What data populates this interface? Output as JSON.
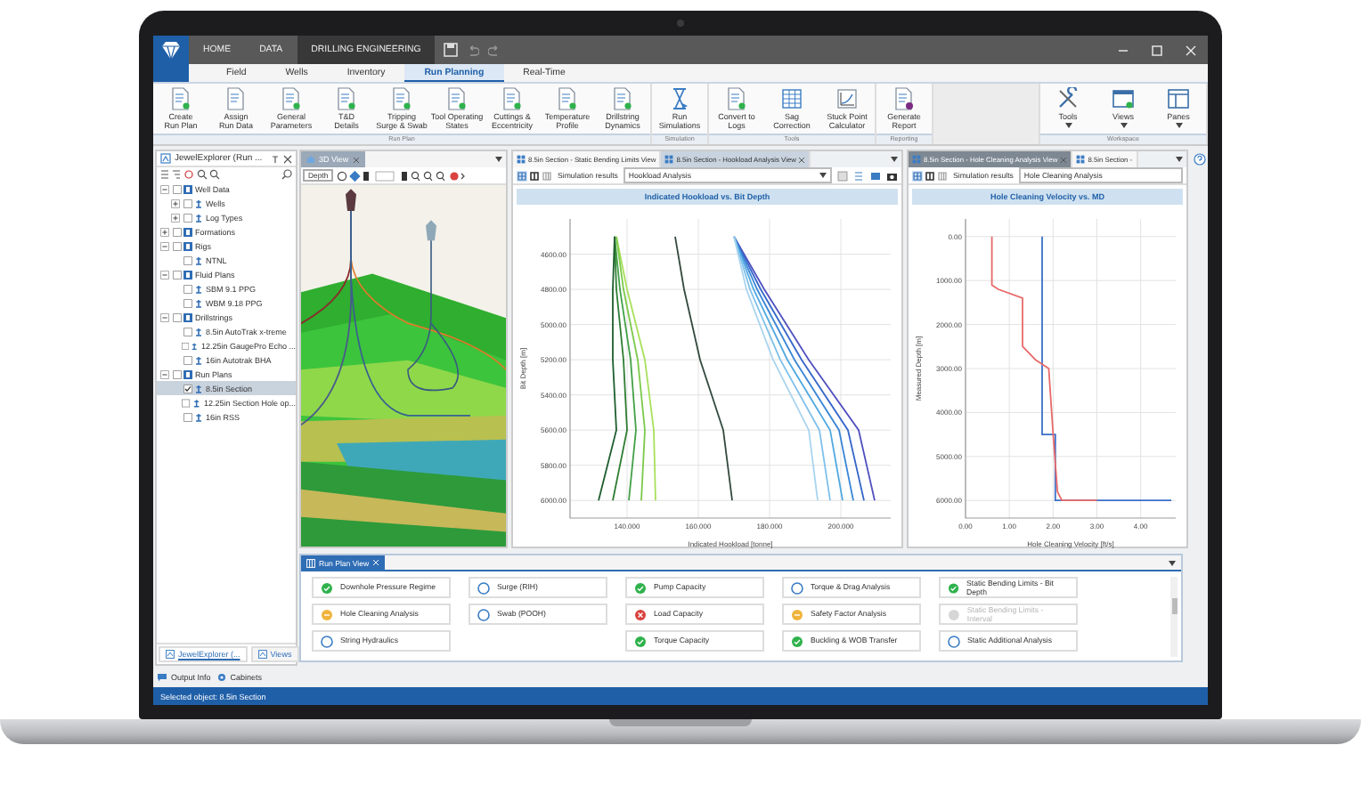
{
  "window": {
    "menu_tabs": [
      {
        "label": "HOME",
        "selected": false
      },
      {
        "label": "DATA",
        "selected": false
      },
      {
        "label": "DRILLING ENGINEERING",
        "selected": true
      }
    ]
  },
  "ribbon_tabs": [
    {
      "label": "Field",
      "selected": false
    },
    {
      "label": "Wells",
      "selected": false
    },
    {
      "label": "Inventory",
      "selected": false
    },
    {
      "label": "Run Planning",
      "selected": true
    },
    {
      "label": "Real-Time",
      "selected": false
    }
  ],
  "ribbon_groups": [
    {
      "label": "Run Plan",
      "buttons": [
        {
          "label": "Create\nRun Plan",
          "kind": "doc",
          "dropdown": false
        },
        {
          "label": "Assign\nRun Data",
          "kind": "list",
          "dropdown": false
        },
        {
          "label": "General\nParameters",
          "kind": "doc",
          "dropdown": false
        },
        {
          "label": "T&D\nDetails",
          "kind": "doc",
          "dropdown": false
        },
        {
          "label": "Tripping\nSurge & Swab",
          "kind": "doc",
          "dropdown": false
        },
        {
          "label": "Tool Operating\nStates",
          "kind": "doc",
          "dropdown": false
        },
        {
          "label": "Cuttings &\nEccentricity",
          "kind": "doc",
          "dropdown": false
        },
        {
          "label": "Temperature\nProfile",
          "kind": "doc",
          "dropdown": false
        },
        {
          "label": "Drillstring\nDynamics",
          "kind": "doc",
          "dropdown": false
        }
      ]
    },
    {
      "label": "Simulation",
      "buttons": [
        {
          "label": "Run\nSimulations",
          "kind": "hourglass",
          "dropdown": false
        }
      ]
    },
    {
      "label": "Tools",
      "buttons": [
        {
          "label": "Convert to\nLogs",
          "kind": "doc",
          "dropdown": false
        },
        {
          "label": "Sag\nCorrection",
          "kind": "table",
          "dropdown": false
        },
        {
          "label": "Stuck Point\nCalculator",
          "kind": "chart",
          "dropdown": false
        }
      ]
    },
    {
      "label": "Reporting",
      "buttons": [
        {
          "label": "Generate\nReport",
          "kind": "report",
          "dropdown": false
        }
      ]
    },
    {
      "label": "Workspace",
      "buttons": [
        {
          "label": "Tools",
          "kind": "tools",
          "dropdown": true
        },
        {
          "label": "Views",
          "kind": "window",
          "dropdown": true
        },
        {
          "label": "Panes",
          "kind": "panes",
          "dropdown": true
        }
      ]
    }
  ],
  "explorer": {
    "title": "JewelExplorer (Run ...",
    "tree": [
      {
        "label": "Well Data",
        "expanded": true,
        "checked": false,
        "selected": false,
        "children": [
          {
            "label": "Wells",
            "expanded": false,
            "checked": false,
            "selected": false
          },
          {
            "label": "Log Types",
            "expanded": false,
            "checked": false,
            "selected": false
          }
        ]
      },
      {
        "label": "Formations",
        "expanded": false,
        "checked": false,
        "selected": false
      },
      {
        "label": "Rigs",
        "expanded": true,
        "checked": false,
        "selected": false,
        "children": [
          {
            "label": "NTNL",
            "checked": false,
            "selected": false
          }
        ]
      },
      {
        "label": "Fluid Plans",
        "expanded": true,
        "checked": false,
        "selected": false,
        "children": [
          {
            "label": "SBM 9.1 PPG",
            "checked": false,
            "selected": false
          },
          {
            "label": "WBM 9.18 PPG",
            "checked": false,
            "selected": false
          }
        ]
      },
      {
        "label": "Drillstrings",
        "expanded": true,
        "checked": false,
        "selected": false,
        "children": [
          {
            "label": "8.5in AutoTrak x-treme",
            "checked": false,
            "selected": false
          },
          {
            "label": "12.25in GaugePro Echo ...",
            "checked": false,
            "selected": false
          },
          {
            "label": "16in Autotrak BHA",
            "checked": false,
            "selected": false
          }
        ]
      },
      {
        "label": "Run Plans",
        "expanded": true,
        "checked": false,
        "selected": false,
        "children": [
          {
            "label": "8.5in Section",
            "checked": true,
            "selected": true
          },
          {
            "label": "12.25in Section Hole op...",
            "checked": false,
            "selected": false
          },
          {
            "label": "16in RSS",
            "checked": false,
            "selected": false
          }
        ]
      }
    ],
    "bottom_tabs": [
      {
        "label": "JewelExplorer (...",
        "selected": true
      },
      {
        "label": "Views",
        "selected": false
      }
    ]
  },
  "view_3d": {
    "tab": "3D View",
    "depth_label": "Depth"
  },
  "doc_panes": [
    {
      "tabs": [
        {
          "label": "8.5in Section - Static Bending Limits View",
          "selected": false
        },
        {
          "label": "8.5in Section - Hookload Analysis View",
          "selected": true
        }
      ],
      "simulation_label": "Simulation results",
      "simulation_value": "Hookload Analysis",
      "chart_data": {
        "type": "line",
        "title": "Indicated Hookload vs. Bit Depth",
        "xlabel": "Indicated Hookload [tonne]",
        "ylabel": "Bit Depth [m]",
        "grid": true,
        "xlim": [
          124,
          214
        ],
        "ylim": [
          6100,
          4400
        ],
        "xticks": [
          {
            "value": 140,
            "label": "140.000"
          },
          {
            "value": 160,
            "label": "160.000"
          },
          {
            "value": 180,
            "label": "180.000"
          },
          {
            "value": 200,
            "label": "200.000"
          }
        ],
        "yticks": [
          {
            "value": 4600,
            "label": "4600.00"
          },
          {
            "value": 4800,
            "label": "4800.00"
          },
          {
            "value": 5000,
            "label": "5000.00"
          },
          {
            "value": 5200,
            "label": "5200.00"
          },
          {
            "value": 5400,
            "label": "5400.00"
          },
          {
            "value": 5600,
            "label": "5600.00"
          },
          {
            "value": 5800,
            "label": "5800.00"
          },
          {
            "value": 6000,
            "label": "6000.00"
          }
        ],
        "series": [
          {
            "color": "#1e5e2e",
            "x": [
              136.5,
              136,
              136,
              137,
              132
            ],
            "values": [
              4500,
              4800,
              5200,
              5600,
              6000
            ]
          },
          {
            "color": "#2e7d32",
            "x": [
              136.5,
              137,
              139,
              140,
              136
            ],
            "values": [
              4500,
              4800,
              5200,
              5600,
              6000
            ]
          },
          {
            "color": "#43a047",
            "x": [
              136.5,
              138,
              141,
              142.5,
              140.5
            ],
            "values": [
              4500,
              4800,
              5200,
              5600,
              6000
            ]
          },
          {
            "color": "#7cc94a",
            "x": [
              137,
              139,
              143,
              145,
              144
            ],
            "values": [
              4500,
              4800,
              5200,
              5600,
              6000
            ]
          },
          {
            "color": "#a8e05a",
            "x": [
              137,
              140,
              145,
              147.5,
              148
            ],
            "values": [
              4500,
              4800,
              5200,
              5600,
              6000
            ]
          },
          {
            "color": "#33493d",
            "x": [
              153.5,
              156,
              160.5,
              167,
              169.5
            ],
            "values": [
              4500,
              4800,
              5200,
              5600,
              6000
            ]
          },
          {
            "color": "#a8d4f0",
            "x": [
              170,
              173.5,
              181,
              191,
              193.5
            ],
            "values": [
              4500,
              4800,
              5200,
              5600,
              6000
            ]
          },
          {
            "color": "#7ec0ea",
            "x": [
              170,
              174.5,
              183,
              194,
              197
            ],
            "values": [
              4500,
              4800,
              5200,
              5600,
              6000
            ]
          },
          {
            "color": "#4fa8e0",
            "x": [
              170,
              175.5,
              185,
              197,
              200.5
            ],
            "values": [
              4500,
              4800,
              5200,
              5600,
              6000
            ]
          },
          {
            "color": "#3a86d6",
            "x": [
              170,
              176.5,
              187,
              199.5,
              203.5
            ],
            "values": [
              4500,
              4800,
              5200,
              5600,
              6000
            ]
          },
          {
            "color": "#3566c9",
            "x": [
              170,
              177.5,
              189,
              202,
              206.5
            ],
            "values": [
              4500,
              4800,
              5200,
              5600,
              6000
            ]
          },
          {
            "color": "#5050c0",
            "x": [
              170,
              178.5,
              191,
              205,
              209.5
            ],
            "values": [
              4500,
              4800,
              5200,
              5600,
              6000
            ]
          }
        ]
      }
    },
    {
      "tabs": [
        {
          "label": "8.5in Section - Hole Cleaning Analysis View",
          "selected": true
        },
        {
          "label": "8.5in Section -",
          "selected": false
        }
      ],
      "simulation_label": "Simulation results",
      "simulation_value": "Hole Cleaning Analysis",
      "chart_data": {
        "type": "line",
        "title": "Hole Cleaning Velocity vs. MD",
        "xlabel": "Hole Cleaning Velocity [ft/s]",
        "ylabel": "Measured Depth [m]",
        "grid": true,
        "xlim": [
          0,
          4.8
        ],
        "ylim": [
          6400,
          -400
        ],
        "xticks": [
          {
            "value": 0,
            "label": "0.00"
          },
          {
            "value": 1,
            "label": "1.00"
          },
          {
            "value": 2,
            "label": "2.00"
          },
          {
            "value": 3,
            "label": "3.00"
          },
          {
            "value": 4,
            "label": "4.00"
          }
        ],
        "yticks": [
          {
            "value": 0,
            "label": "0.00"
          },
          {
            "value": 1000,
            "label": "1000.00"
          },
          {
            "value": 2000,
            "label": "2000.00"
          },
          {
            "value": 3000,
            "label": "3000.00"
          },
          {
            "value": 4000,
            "label": "4000.00"
          },
          {
            "value": 5000,
            "label": "5000.00"
          },
          {
            "value": 6000,
            "label": "6000.00"
          }
        ],
        "series": [
          {
            "color": "#e86a6a",
            "x": [
              0.6,
              0.6,
              0.75,
              1.3,
              1.3,
              1.6,
              1.9,
              2.0,
              2.1,
              2.2,
              3.0
            ],
            "values": [
              0,
              1100,
              1200,
              1400,
              2500,
              2800,
              3000,
              4500,
              5800,
              6000,
              6000
            ]
          },
          {
            "color": "#3a6fc9",
            "x": [
              1.75,
              1.75,
              2.05,
              2.05,
              4.7
            ],
            "values": [
              0,
              4500,
              4500,
              6000,
              6000
            ]
          }
        ]
      }
    }
  ],
  "run_plan": {
    "tab": "Run Plan View",
    "columns": [
      [
        {
          "label": "Downhole Pressure Regime",
          "kind": "ok"
        },
        {
          "label": "Hole Cleaning Analysis",
          "kind": "warning"
        },
        {
          "label": "String Hydraulics",
          "kind": "pending"
        }
      ],
      [
        {
          "label": "Surge (RIH)",
          "kind": "pending"
        },
        {
          "label": "Swab (POOH)",
          "kind": "pending"
        }
      ],
      [
        {
          "label": "Pump Capacity",
          "kind": "ok"
        },
        {
          "label": "Load Capacity",
          "kind": "error"
        },
        {
          "label": "Torque Capacity",
          "kind": "ok"
        }
      ],
      [
        {
          "label": "Torque & Drag Analysis",
          "kind": "pending"
        },
        {
          "label": "Safety Factor Analysis",
          "kind": "warning"
        },
        {
          "label": "Buckling & WOB Transfer",
          "kind": "ok"
        }
      ],
      [
        {
          "label": "Static Bending Limits - Bit Depth",
          "kind": "ok"
        },
        {
          "label": "Static Bending Limits - Interval",
          "kind": "disabled"
        },
        {
          "label": "Static Additional Analysis",
          "kind": "pending"
        }
      ]
    ]
  },
  "output_tabs": [
    "Output Info",
    "Cabinets"
  ],
  "status_bar": "Selected object: 8.5in Section"
}
